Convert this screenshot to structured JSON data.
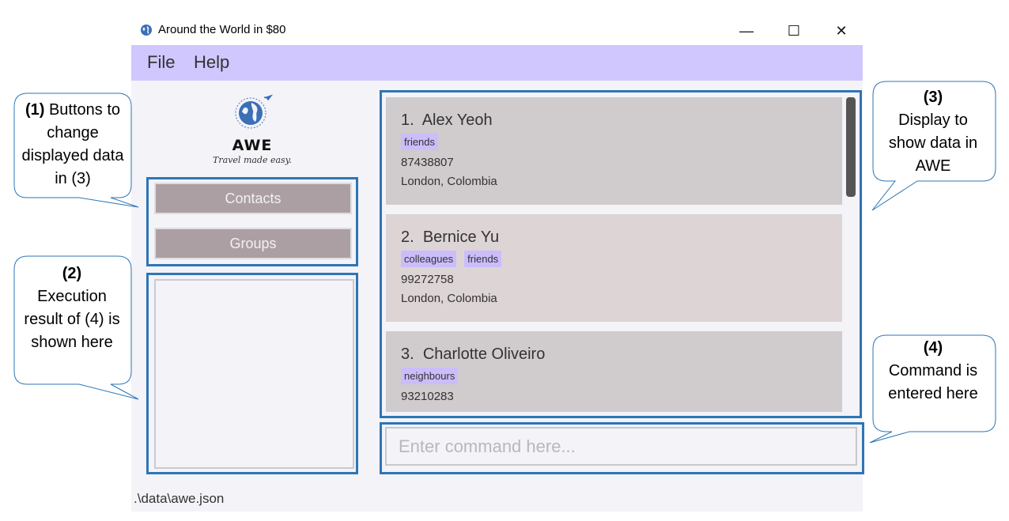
{
  "window": {
    "title": "Around the World in $80",
    "icon": "globe-icon",
    "controls": {
      "minimize": "—",
      "maximize": "☐",
      "close": "✕"
    }
  },
  "menu": {
    "file": "File",
    "help": "Help"
  },
  "logo": {
    "title": "AWE",
    "tagline": "Travel made easy."
  },
  "nav": {
    "contacts": "Contacts",
    "groups": "Groups"
  },
  "contacts": [
    {
      "index": "1.",
      "name": "Alex Yeoh",
      "tags": [
        "friends"
      ],
      "phone": "87438807",
      "address": "London, Colombia"
    },
    {
      "index": "2.",
      "name": "Bernice Yu",
      "tags": [
        "colleagues",
        "friends"
      ],
      "phone": "99272758",
      "address": "London, Colombia"
    },
    {
      "index": "3.",
      "name": "Charlotte Oliveiro",
      "tags": [
        "neighbours"
      ],
      "phone": "93210283",
      "address": ""
    }
  ],
  "command": {
    "placeholder": "Enter command here...",
    "value": ""
  },
  "status": {
    "path": ".\\data\\awe.json"
  },
  "callouts": {
    "c1": {
      "num": "(1)",
      "text": "Buttons to change displayed data in (3)"
    },
    "c2": {
      "num": "(2)",
      "text": "Execution result of (4) is shown here"
    },
    "c3": {
      "num": "(3)",
      "text": "Display to show data in AWE"
    },
    "c4": {
      "num": "(4)",
      "text": "Command is entered here"
    }
  },
  "colors": {
    "menubar": "#cfc7fd",
    "tag": "#cbbdfa",
    "nav_button": "#ab9fa4",
    "card_odd": "#d0cbcc",
    "card_even": "#ddd4d5",
    "annotation_border": "#2e75b6"
  }
}
